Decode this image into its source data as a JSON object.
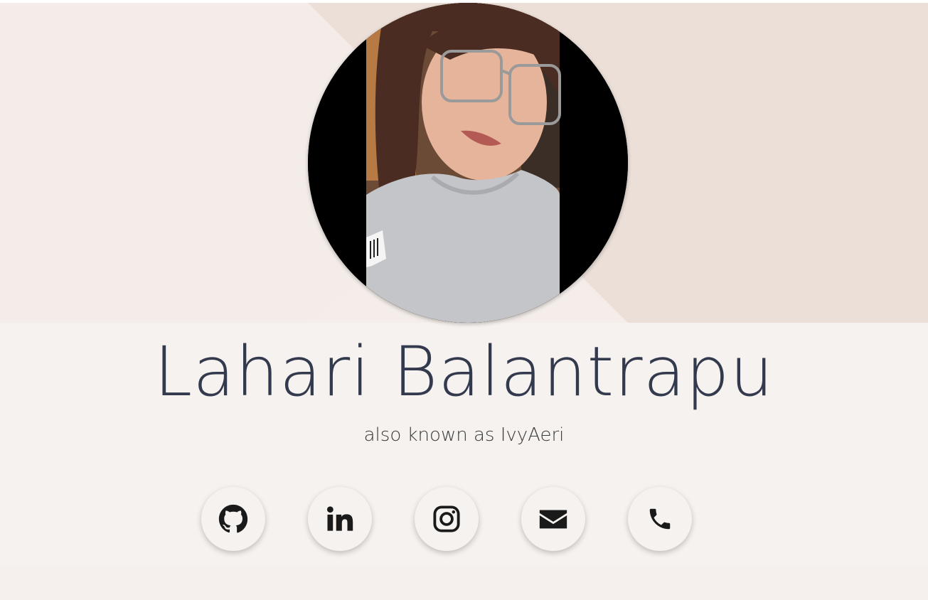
{
  "profile": {
    "name": "Lahari Balantrapu",
    "alias": "also known as IvyAeri"
  },
  "socials": [
    {
      "icon": "github-icon"
    },
    {
      "icon": "linkedin-icon"
    },
    {
      "icon": "instagram-icon"
    },
    {
      "icon": "envelope-icon"
    },
    {
      "icon": "phone-icon"
    }
  ],
  "colors": {
    "background": "#f6f2ef",
    "hero_left": "#f3ece8",
    "hero_right": "#ebdfd8",
    "name_text": "#343a4d",
    "icon": "#1a1a1a"
  }
}
